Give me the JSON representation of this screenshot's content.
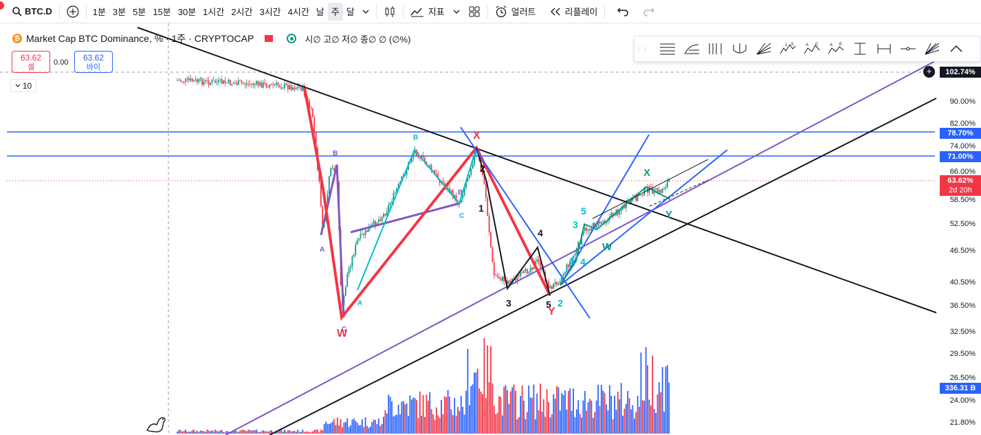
{
  "toolbar": {
    "symbol": "BTC.D",
    "intervals": [
      "1분",
      "3분",
      "5분",
      "15분",
      "30분",
      "1시간",
      "2시간",
      "3시간",
      "4시간",
      "날",
      "주",
      "달"
    ],
    "active_interval": "주",
    "indicators_label": "지표",
    "alert_label": "얼러트",
    "replay_label": "리플레이"
  },
  "legend": {
    "title": "Market Cap BTC Dominance, % · 1주 · CRYPTOCAP",
    "coin_glyph": "₿",
    "ohlc": "시∅ 고∅ 저∅ 종∅ ∅ (∅%)",
    "sell_price": "63.62",
    "sell_label": "셀",
    "spread": "0.00",
    "buy_price": "63.62",
    "buy_label": "바이",
    "collapse_count": "10"
  },
  "price_axis": {
    "labels": [
      "90.00%",
      "82.00%",
      "74.00%",
      "66.00%",
      "58.50%",
      "52.50%",
      "46.50%",
      "40.50%",
      "36.50%",
      "32.50%",
      "29.50%",
      "26.50%",
      "24.00%",
      "21.80%"
    ],
    "top_badge": "102.74%",
    "line1_badge": "78.70%",
    "line2_badge": "71.00%",
    "current_price": "63.62%",
    "countdown": "2d 20h",
    "volume_badge": "336.31 B"
  },
  "colors": {
    "up": "#089981",
    "down": "#f23645",
    "accent": "#2962ff",
    "purple": "#7e57c2",
    "cyan": "#00bcd4"
  },
  "wave_labels": {
    "W1": "W",
    "A1": "A",
    "B1": "B",
    "C1": "C",
    "A2": "A",
    "B2": "B",
    "C2": "C",
    "B3": "B",
    "X1": "X",
    "n1": "1",
    "n2": "2",
    "n3": "3",
    "n4": "4",
    "n5": "5",
    "Y1": "Y",
    "c1": "1",
    "c2": "2",
    "c3": "3",
    "c4": "4",
    "c5": "5",
    "W2": "W",
    "X2": "X",
    "Y2": "Y"
  }
}
